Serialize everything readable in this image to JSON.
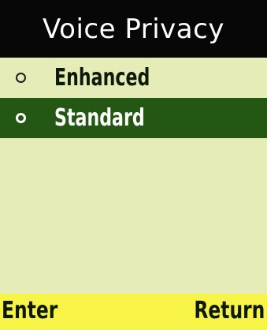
{
  "screen": {
    "title": "Voice Privacy"
  },
  "options": [
    {
      "label": "Enhanced",
      "selected": false
    },
    {
      "label": "Standard",
      "selected": true
    }
  ],
  "softkeys": {
    "left": "Enter",
    "right": "Return"
  },
  "colors": {
    "title_bar_bg": "#070707",
    "body_bg": "#e6ecb7",
    "selection_bg": "#235713",
    "softkey_bar_bg": "#f7f447"
  }
}
